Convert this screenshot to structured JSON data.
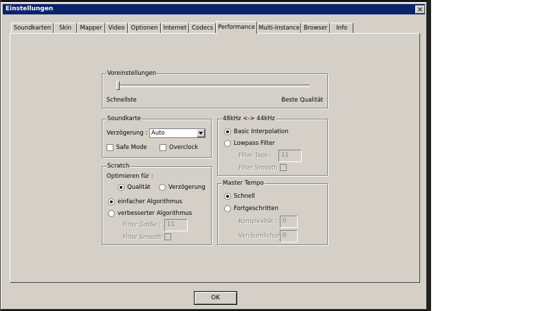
{
  "window": {
    "title": "Einstellungen",
    "close_symbol": "×"
  },
  "tabs": [
    {
      "label": "Soundkarten"
    },
    {
      "label": "Skin"
    },
    {
      "label": "Mapper"
    },
    {
      "label": "Video"
    },
    {
      "label": "Optionen"
    },
    {
      "label": "Internet"
    },
    {
      "label": "Codecs"
    },
    {
      "label": "Performance"
    },
    {
      "label": "Multi-Instance"
    },
    {
      "label": "Browser"
    },
    {
      "label": "Info"
    }
  ],
  "active_tab": "Performance",
  "presets": {
    "legend": "Voreinstellungen",
    "left_label": "Schnellste",
    "right_label": "Beste Qualität",
    "slider_value": 0
  },
  "soundkarte": {
    "legend": "Soundkarte",
    "latency_label": "Verzögerung :",
    "latency_value": "Auto",
    "safe_mode_label": "Safe Mode",
    "safe_mode_checked": false,
    "overclock_label": "Overclock",
    "overclock_checked": false
  },
  "resample": {
    "legend": "48kHz <-> 44kHz",
    "basic_label": "Basic Interpolation",
    "lowpass_label": "Lowpass Filter",
    "filter_taps_label": "Filter Taps :",
    "filter_taps_value": "11",
    "filter_smooth_label": "Filter Smooth",
    "selected": "basic"
  },
  "scratch": {
    "legend": "Scratch",
    "optimize_label": "Optimieren für :",
    "quality_label": "Qualität",
    "latency_label": "Verzögerung",
    "simple_algo_label": "einfacher Algorithmus",
    "improved_algo_label": "verbesserter Algorithmus",
    "filter_size_label": "Filter Größe :",
    "filter_size_value": "11",
    "filter_smooth_label": "Filter Smooth"
  },
  "master_tempo": {
    "legend": "Master Tempo",
    "fast_label": "Schnell",
    "advanced_label": "Fortgeschritten",
    "complexity_label": "Komplexität :",
    "complexity_value": "0",
    "spatial_label": "Verräumlichung",
    "spatial_value": "0"
  },
  "ok_label": "OK"
}
